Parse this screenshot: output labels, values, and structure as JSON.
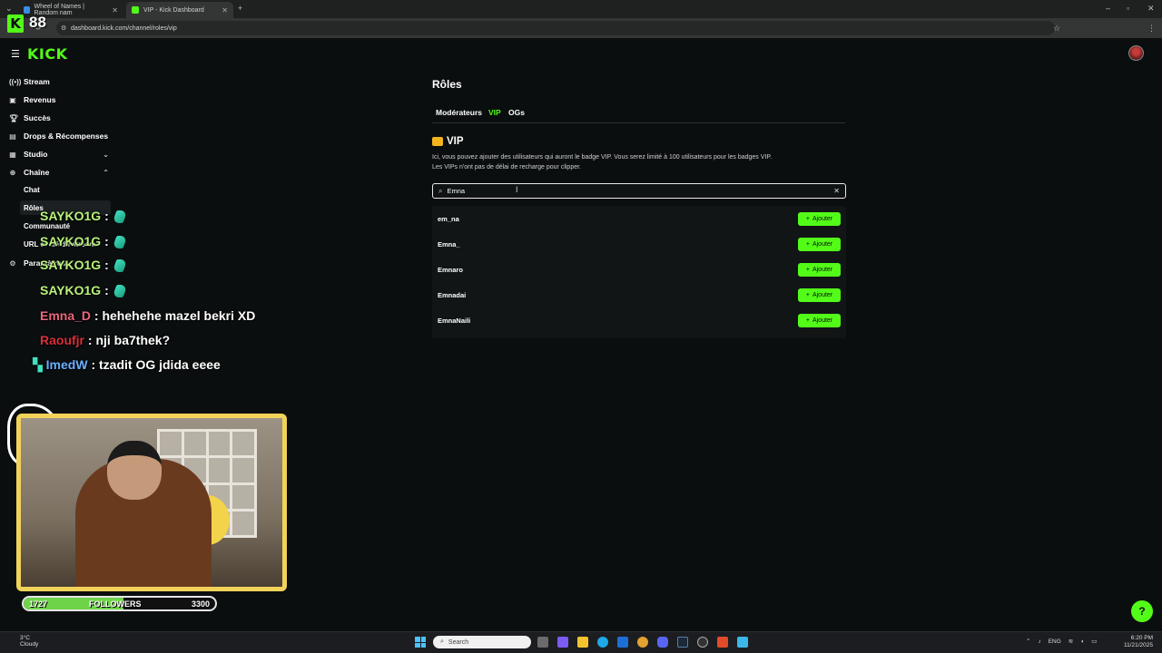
{
  "browser": {
    "tabs": [
      {
        "label": "Wheel of Names | Random nam",
        "active": false
      },
      {
        "label": "VIP - Kick Dashboard",
        "active": true
      }
    ],
    "url": "dashboard.kick.com/channel/roles/vip"
  },
  "stream_counter": "88",
  "brand": {
    "logo": "KICK",
    "accent": "#53fc18"
  },
  "sidebar": {
    "items": [
      {
        "label": "Stream",
        "icon": "stream-icon"
      },
      {
        "label": "Revenus",
        "icon": "revenue-icon"
      },
      {
        "label": "Succès",
        "icon": "trophy-icon"
      },
      {
        "label": "Drops & Récompenses",
        "icon": "gift-icon"
      },
      {
        "label": "Studio",
        "icon": "studio-icon"
      },
      {
        "label": "Chaîne",
        "icon": "channel-icon"
      },
      {
        "label": "Paramètres",
        "icon": "gear-icon"
      }
    ],
    "subitems": [
      "Chat",
      "Rôles",
      "Communauté",
      "URL et clé du stream"
    ]
  },
  "overlay_chat": [
    {
      "name": "SAYKO1G",
      "msg": ":",
      "name_color": "#b9f27c"
    },
    {
      "name": "SAYKO1G",
      "msg": ":",
      "name_color": "#b9f27c"
    },
    {
      "name": "SAYKO1G",
      "msg": ":",
      "name_color": "#b9f27c"
    },
    {
      "name": "SAYKO1G",
      "msg": ":",
      "name_color": "#b9f27c"
    },
    {
      "name": "Emna_D",
      "msg": ": hehehehe mazel bekri XD",
      "name_color": "#e8677a"
    },
    {
      "name": "Raoufjr",
      "msg": ": nji ba7thek?",
      "name_color": "#d8303a"
    },
    {
      "name": "ImedW",
      "msg": ": tzadit OG jdida eeee",
      "name_color": "#6ab0ff"
    }
  ],
  "followers": {
    "current": "1727",
    "label": "FOLLOWERS",
    "goal": "3300",
    "progress": 0.52
  },
  "main": {
    "title": "Rôles",
    "tabs": [
      "Modérateurs",
      "VIP",
      "OGs"
    ],
    "active_tab": "VIP",
    "section_title": "VIP",
    "description_1": "Ici, vous pouvez ajouter des utilisateurs qui auront le badge VIP. Vous serez limité à 100 utilisateurs pour les badges VIP.",
    "description_2": "Les VIPs n'ont pas de délai de recharge pour clipper.",
    "search_value": "Emna",
    "add_label": "Ajouter",
    "results": [
      "em_na",
      "Emna_",
      "Emnaro",
      "Emnadai",
      "EmnaNaili"
    ]
  },
  "taskbar": {
    "weather_temp": "3°C",
    "weather_desc": "Cloudy",
    "search_placeholder": "Search",
    "lang": "ENG",
    "time": "6:20 PM",
    "date": "11/21/2025"
  }
}
